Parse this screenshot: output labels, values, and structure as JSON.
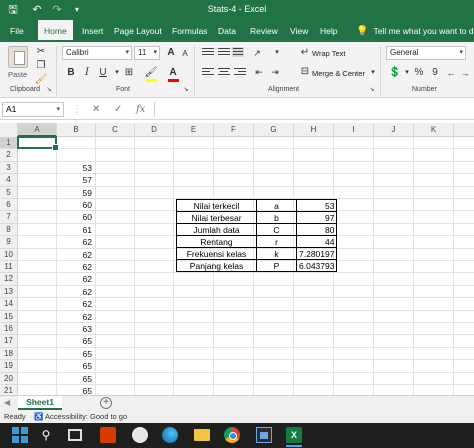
{
  "titlebar": {
    "title": "Stats-4  -  Excel",
    "save_icon": "save-icon",
    "undo_icon": "undo-icon",
    "redo_icon": "redo-icon",
    "customize_icon": "chevron-down-icon"
  },
  "tabs": {
    "file": "File",
    "home": "Home",
    "insert": "Insert",
    "page_layout": "Page Layout",
    "formulas": "Formulas",
    "data": "Data",
    "review": "Review",
    "view": "View",
    "help": "Help",
    "tell_me": "Tell me what you want to do"
  },
  "ribbon": {
    "clipboard": {
      "paste": "Paste",
      "label": "Clipboard"
    },
    "font": {
      "name": "Calibri",
      "size": "11",
      "bold": "B",
      "italic": "I",
      "underline": "U",
      "grow": "A",
      "shrink": "A",
      "font_color_letter": "A",
      "label": "Font",
      "font_color": "#ff0000",
      "fill_color": "#ffff00"
    },
    "alignment": {
      "wrap_text": "Wrap Text",
      "merge_center": "Merge & Center",
      "label": "Alignment"
    },
    "number": {
      "format": "General",
      "percent": "%",
      "comma": "9",
      "label": "Number"
    }
  },
  "formula_bar": {
    "name_box": "A1",
    "cancel": "✕",
    "enter": "✓",
    "fx": "fx",
    "value": ""
  },
  "columns": [
    "A",
    "B",
    "C",
    "D",
    "E",
    "F",
    "G",
    "H",
    "I",
    "J",
    "K"
  ],
  "rows": [
    "1",
    "2",
    "3",
    "4",
    "5",
    "6",
    "7",
    "8",
    "9",
    "10",
    "11",
    "12",
    "13",
    "14",
    "15",
    "16",
    "17",
    "18",
    "19",
    "20",
    "21"
  ],
  "column_b": [
    "",
    "",
    "53",
    "57",
    "59",
    "60",
    "60",
    "61",
    "62",
    "62",
    "62",
    "62",
    "62",
    "62",
    "62",
    "63",
    "65",
    "65",
    "65",
    "65",
    "65"
  ],
  "stats_table": [
    {
      "label": "Nilai terkecil",
      "symbol": "a",
      "value": "53"
    },
    {
      "label": "Nilai terbesar",
      "symbol": "b",
      "value": "97"
    },
    {
      "label": "Jumlah data",
      "symbol": "C",
      "value": "80"
    },
    {
      "label": "Rentang",
      "symbol": "r",
      "value": "44"
    },
    {
      "label": "Frekuensi kelas",
      "symbol": "k",
      "value": "7.280197"
    },
    {
      "label": "Panjang kelas",
      "symbol": "P",
      "value": "6.043793"
    }
  ],
  "sheets": {
    "active": "Sheet1",
    "add": "+"
  },
  "status": {
    "ready": "Ready",
    "accessibility": "Accessibility: Good to go"
  },
  "colors": {
    "excel_green": "#217346",
    "taskbar": "#1f1f1f"
  }
}
